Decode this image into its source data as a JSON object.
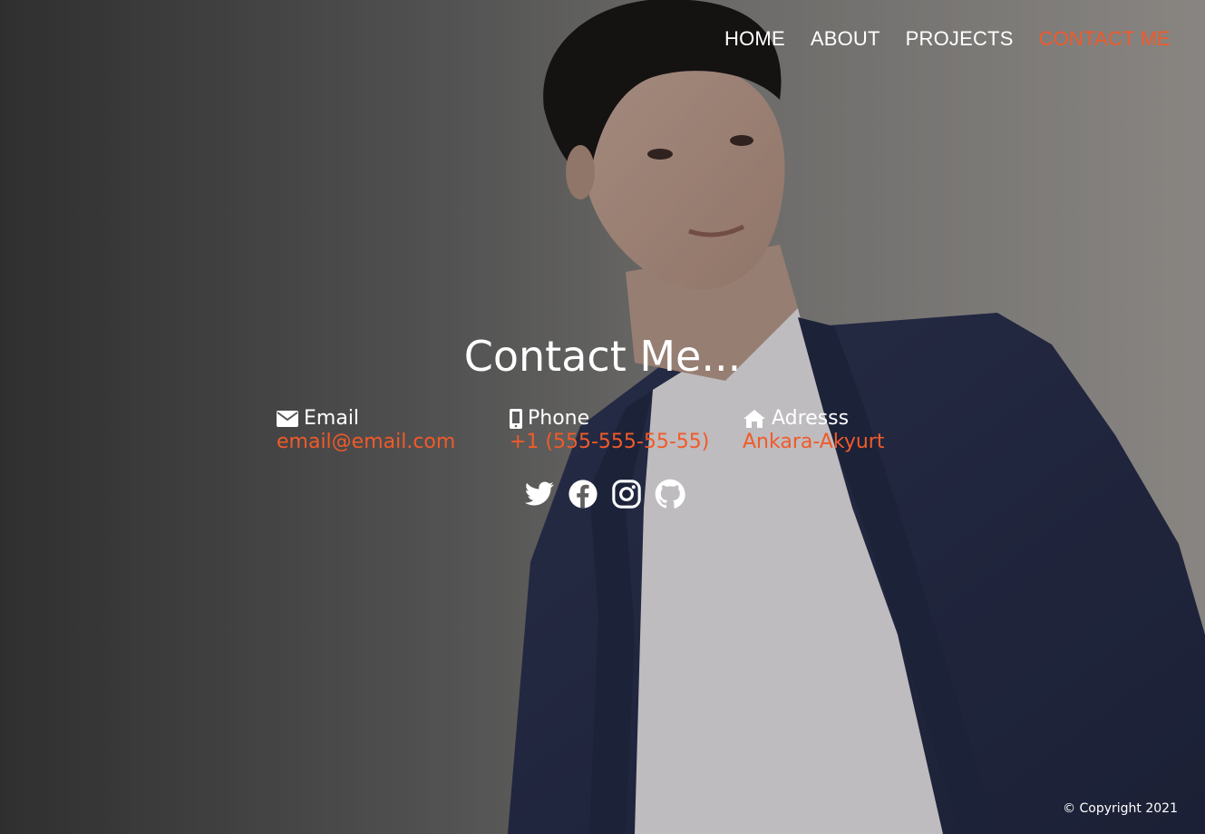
{
  "nav": {
    "items": [
      {
        "label": "HOME",
        "active": false
      },
      {
        "label": "ABOUT",
        "active": false
      },
      {
        "label": "PROJECTS",
        "active": false
      },
      {
        "label": "CONTACT ME",
        "active": true
      }
    ]
  },
  "main": {
    "heading": "Contact Me...",
    "contacts": [
      {
        "icon": "envelope-icon",
        "label": "Email",
        "value": "email@email.com"
      },
      {
        "icon": "mobile-phone-icon",
        "label": "Phone",
        "value": "+1 (555-555-55-55)"
      },
      {
        "icon": "home-icon",
        "label": "Adresss",
        "value": "Ankara-Akyurt"
      }
    ],
    "socials": [
      "twitter-icon",
      "facebook-icon",
      "instagram-icon",
      "github-icon"
    ]
  },
  "footer": {
    "copyright": "© Copyright 2021"
  },
  "colors": {
    "accent": "#f15a29",
    "text": "#ffffff",
    "suit": "#2b3250",
    "shirt": "#ecebee"
  }
}
